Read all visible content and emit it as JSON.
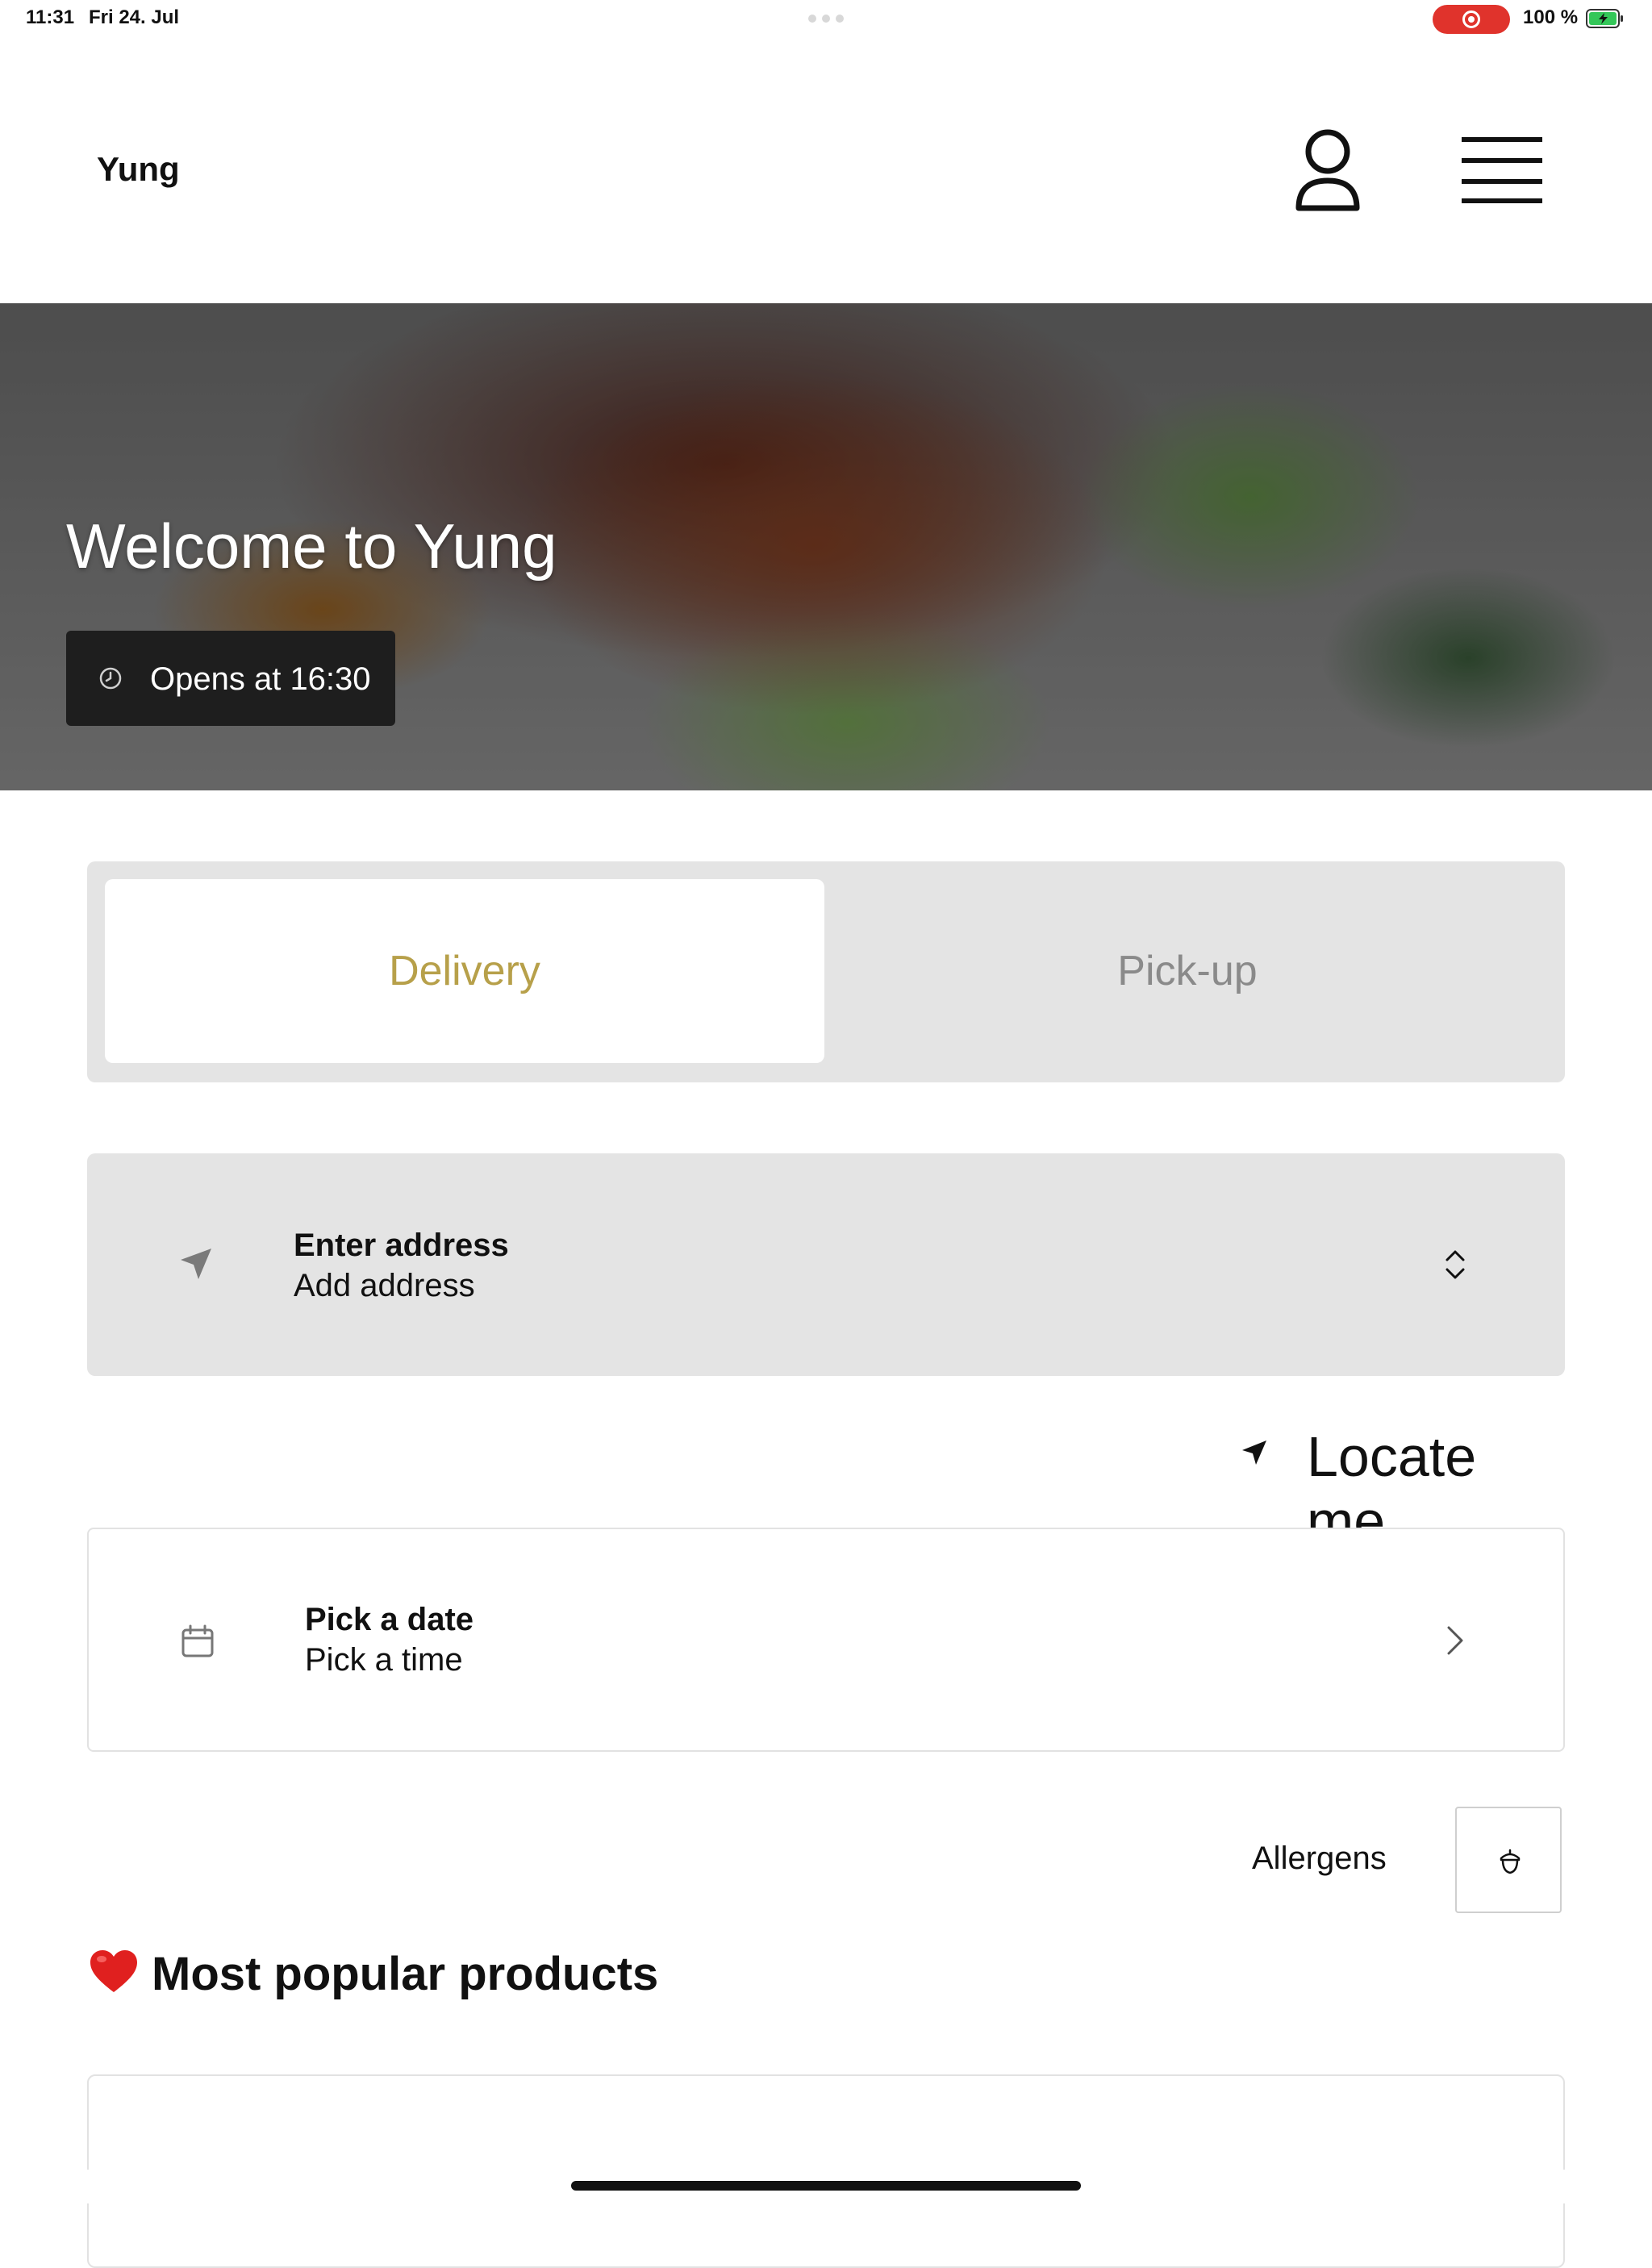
{
  "status_bar": {
    "time": "11:31",
    "date": "Fri 24. Jul",
    "battery": "100 %"
  },
  "header": {
    "brand": "Yung"
  },
  "hero": {
    "title": "Welcome to Yung",
    "opens": "Opens at 16:30"
  },
  "mode_toggle": {
    "delivery": "Delivery",
    "pickup": "Pick-up",
    "selected": "Delivery"
  },
  "address": {
    "title": "Enter address",
    "subtitle": "Add address"
  },
  "locate": {
    "label": "Locate me"
  },
  "schedule": {
    "date_label": "Pick a date",
    "time_label": "Pick a time"
  },
  "allergens": {
    "label": "Allergens"
  },
  "popular": {
    "title": "Most popular products"
  },
  "colors": {
    "accent": "#b7a04a",
    "toggle_bg": "#e4e4e4",
    "badge_bg": "#1e1e1e",
    "recording": "#e0332c"
  }
}
